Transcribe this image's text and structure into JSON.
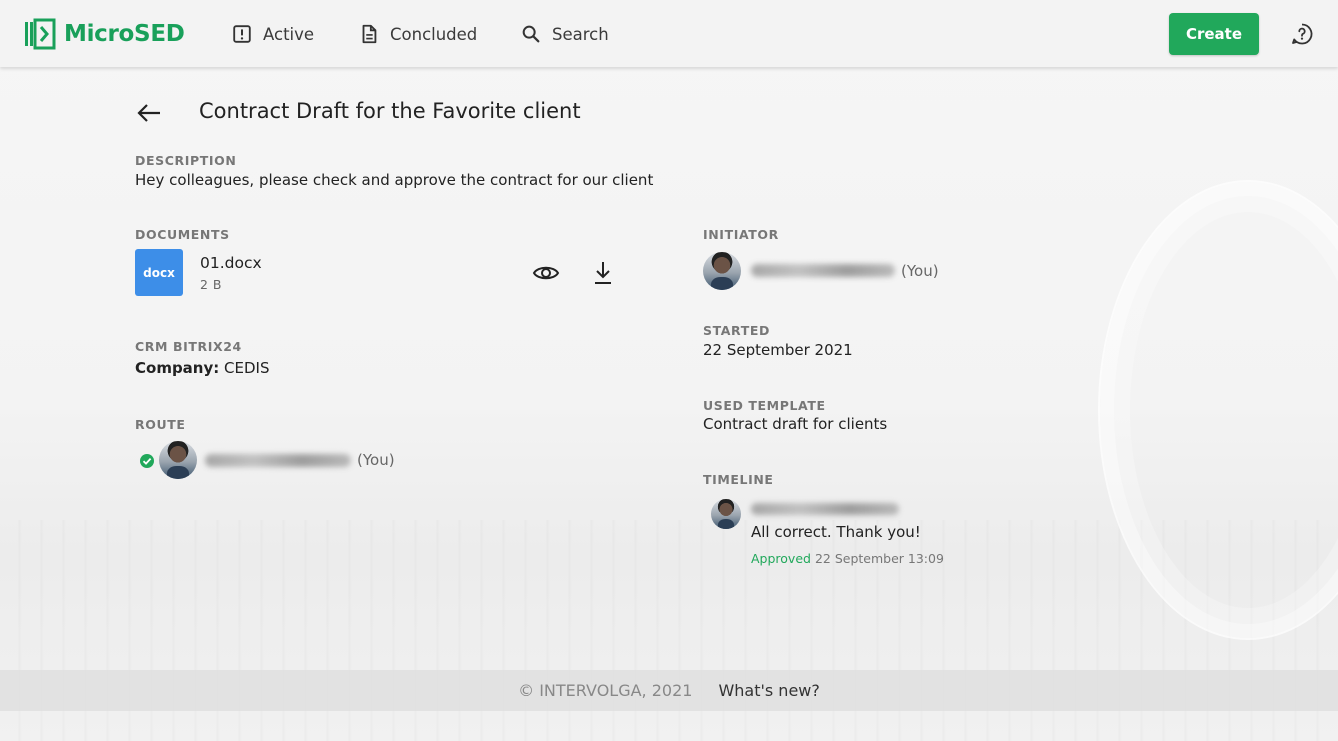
{
  "app": {
    "name": "MicroSED",
    "brand_color": "#19a05a"
  },
  "nav": {
    "items": [
      {
        "label": "Active",
        "icon": "alert-square-icon"
      },
      {
        "label": "Concluded",
        "icon": "document-icon"
      },
      {
        "label": "Search",
        "icon": "search-icon"
      }
    ],
    "create_label": "Create"
  },
  "page": {
    "title": "Contract Draft for the Favorite client"
  },
  "description": {
    "label": "DESCRIPTION",
    "text": "Hey colleagues, please check and approve the contract for our client"
  },
  "documents": {
    "label": "DOCUMENTS",
    "items": [
      {
        "icon_text": "docx",
        "name": "01.docx",
        "size": "2 B"
      }
    ]
  },
  "crm": {
    "label": "CRM BITRIX24",
    "company_label": "Company:",
    "company_value": "CEDIS"
  },
  "route": {
    "label": "ROUTE",
    "you": "(You)",
    "status": "approved"
  },
  "initiator": {
    "label": "INITIATOR",
    "you": "(You)"
  },
  "started": {
    "label": "STARTED",
    "value": "22 September 2021"
  },
  "template": {
    "label": "USED TEMPLATE",
    "value": "Contract draft for clients"
  },
  "timeline": {
    "label": "TIMELINE",
    "entries": [
      {
        "comment": "All correct. Thank you!",
        "status": "Approved",
        "time": "22 September 13:09"
      }
    ]
  },
  "footer": {
    "copyright": "© INTERVOLGA, 2021",
    "whats_new": "What's new?"
  }
}
